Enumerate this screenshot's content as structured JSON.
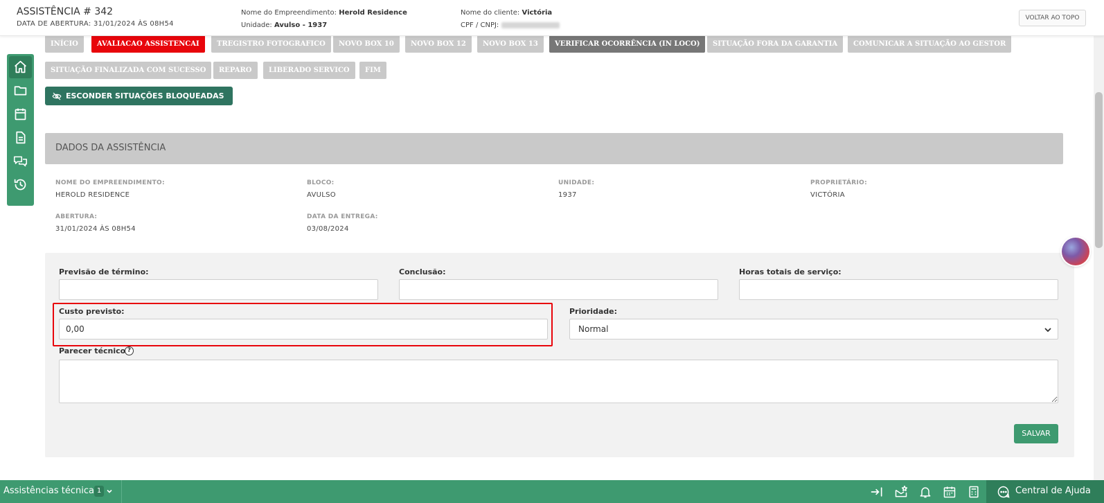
{
  "header": {
    "title": "ASSISTÊNCIA # 342",
    "opening": "DATA DE ABERTURA: 31/01/2024 ÀS 08H54",
    "enterprise_label": "Nome do Empreendimento:",
    "enterprise_value": "Herold Residence",
    "unit_label": "Unidade:",
    "unit_value": "Avulso - 1937",
    "client_label": "Nome do cliente:",
    "client_value": "Victória",
    "cpf_label": "CPF / CNPJ:",
    "back_to_top": "VOLTAR AO TOPO"
  },
  "sidenav": {
    "items": [
      "home-icon",
      "folder-icon",
      "calendar-icon",
      "document-icon",
      "chat-icon",
      "history-icon"
    ]
  },
  "status_buttons": [
    {
      "label": "INÍCIO",
      "state": "inactive"
    },
    {
      "label": "AVALIACAO ASSISTENCAI",
      "state": "current"
    },
    {
      "label": "TREGISTRO FOTOGRAFICO",
      "state": "inactive"
    },
    {
      "label": "NOVO BOX 10",
      "state": "inactive"
    },
    {
      "label": "NOVO BOX 12",
      "state": "inactive"
    },
    {
      "label": "NOVO BOX 13",
      "state": "inactive"
    },
    {
      "label": "VERIFICAR OCORRÊNCIA (IN LOCO)",
      "state": "next"
    },
    {
      "label": "SITUAÇÃO FORA DA GARANTIA",
      "state": "inactive"
    },
    {
      "label": "COMUNICAR A SITUAÇÃO AO GESTOR",
      "state": "inactive"
    },
    {
      "label": "SITUAÇÃO FINALIZADA COM SUCESSO",
      "state": "inactive"
    },
    {
      "label": "REPARO",
      "state": "inactive"
    },
    {
      "label": "LIBERADO SERVICO",
      "state": "inactive"
    },
    {
      "label": "FIM",
      "state": "inactive"
    }
  ],
  "hide_blocked_label": "ESCONDER SITUAÇÕES BLOQUEADAS",
  "section": {
    "title": "DADOS DA ASSISTÊNCIA",
    "fields": [
      {
        "label": "NOME DO EMPREENDIMENTO:",
        "value": "HEROLD RESIDENCE"
      },
      {
        "label": "BLOCO:",
        "value": "AVULSO"
      },
      {
        "label": "UNIDADE:",
        "value": "1937"
      },
      {
        "label": "PROPRIETÁRIO:",
        "value": "VICTÓRIA"
      },
      {
        "label": "ABERTURA:",
        "value": "31/01/2024 ÀS 08H54"
      },
      {
        "label": "DATA DA ENTREGA:",
        "value": "03/08/2024"
      }
    ]
  },
  "form": {
    "previsao_label": "Previsão de término:",
    "previsao_value": "",
    "conclusao_label": "Conclusão:",
    "conclusao_value": "",
    "horas_label": "Horas totais de serviço:",
    "horas_value": "",
    "custo_label": "Custo previsto:",
    "custo_value": "0,00",
    "prioridade_label": "Prioridade:",
    "prioridade_value": "Normal",
    "parecer_label": "Parecer técnico:",
    "help_symbol": "?",
    "save_label": "SALVAR"
  },
  "bottom_bar": {
    "title": "Assistências técnicas",
    "count": "1",
    "help_center": "Central de Ajuda"
  },
  "colors": {
    "primary_green": "#3e9a70",
    "dark_green": "#2f7460",
    "current_red": "#e8050b",
    "next_gray": "#777777",
    "inactive_gray": "#c9c9c9"
  }
}
